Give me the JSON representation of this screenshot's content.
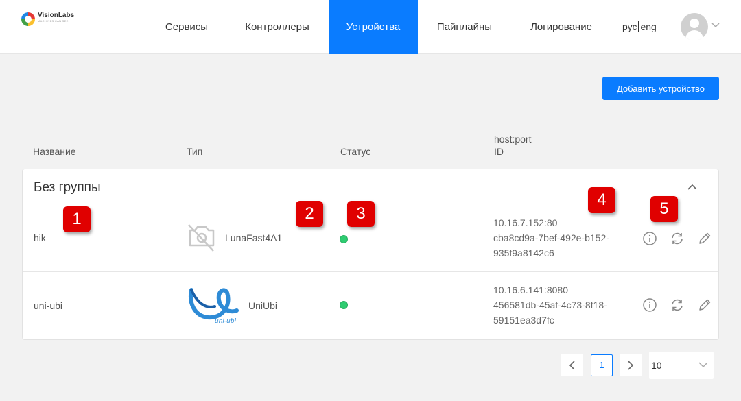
{
  "logo": {
    "name": "VisionLabs",
    "subtitle": "MACHINES CAN SEE"
  },
  "nav": {
    "items": [
      {
        "label": "Сервисы",
        "active": false
      },
      {
        "label": "Контроллеры",
        "active": false
      },
      {
        "label": "Устройства",
        "active": true
      },
      {
        "label": "Пайплайны",
        "active": false
      },
      {
        "label": "Логирование",
        "active": false
      }
    ],
    "lang_ru": "рус",
    "lang_en": "eng"
  },
  "toolbar": {
    "add_device_label": "Добавить устройство"
  },
  "columns": {
    "name": "Название",
    "type": "Тип",
    "status": "Статус",
    "host_port": "host:port",
    "id": "ID"
  },
  "group": {
    "title": "Без группы"
  },
  "devices": [
    {
      "name": "hik",
      "type": "LunaFast4A1",
      "type_icon": "camera-off-icon",
      "status": "online",
      "host_port": "10.16.7.152:80",
      "id_line1": "cba8cd9a-7bef-492e-b152-",
      "id_line2": "935f9a8142c6"
    },
    {
      "name": "uni-ubi",
      "type": "UniUbi",
      "type_icon": "uniubi-logo",
      "logo_text": "uni-ubi",
      "status": "online",
      "host_port": "10.16.6.141:8080",
      "id_line1": "456581db-45af-4c73-8f18-",
      "id_line2": "59151ea3d7fc"
    }
  ],
  "annotations": [
    "1",
    "2",
    "3",
    "4",
    "5"
  ],
  "pagination": {
    "current_page": "1",
    "per_page": "10"
  },
  "colors": {
    "accent": "#0a7cff",
    "status_online": "#2ecc71",
    "annotation": "#e00000"
  }
}
